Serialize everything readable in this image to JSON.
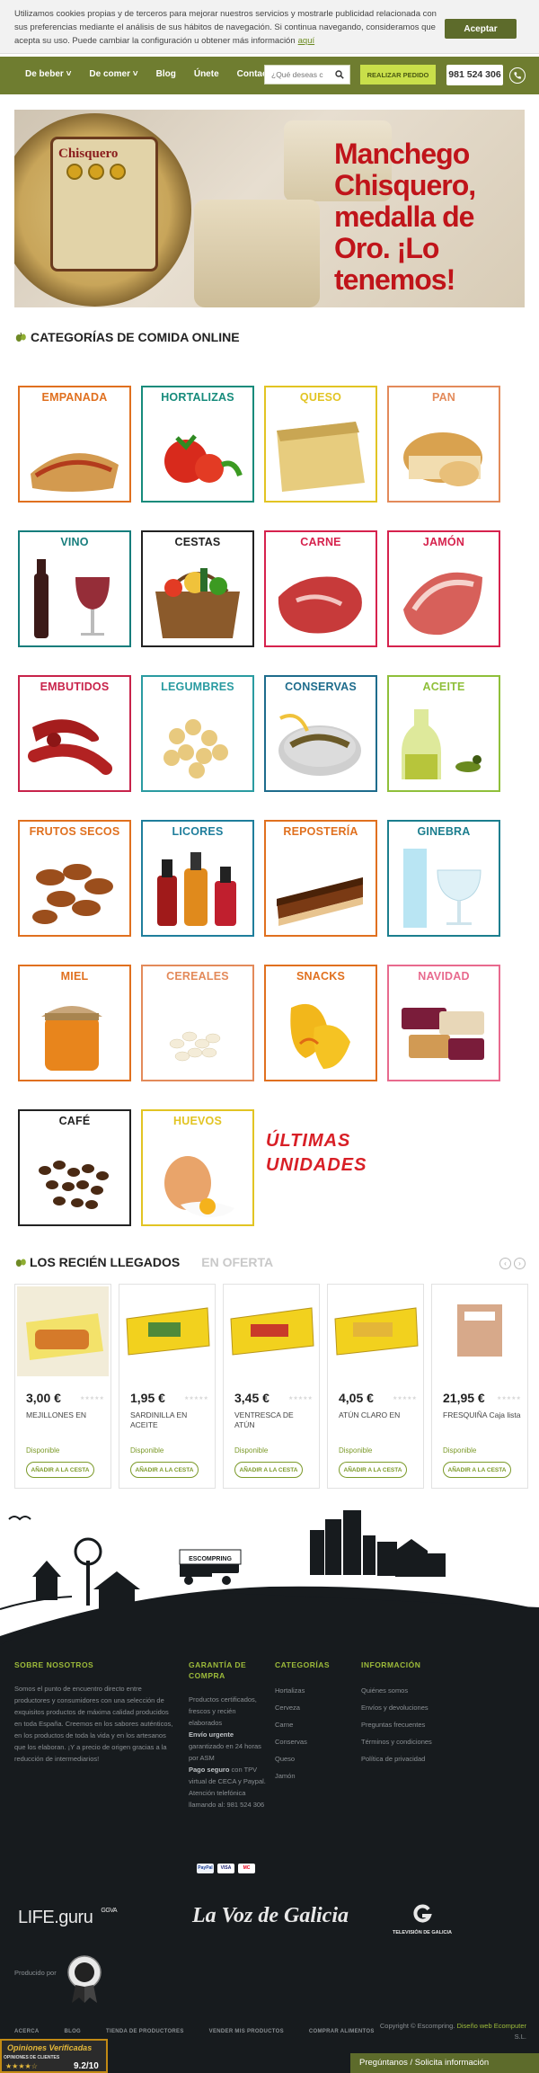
{
  "cookie": {
    "text": "Utilizamos cookies propias y de terceros para mejorar nuestros servicios y mostrarle publicidad relacionada con sus preferencias mediante el análisis de sus hábitos de navegación. Si continua navegando, consideramos que acepta su uso. Puede cambiar la configuración u obtener más información",
    "link": "aquí",
    "accept": "Aceptar"
  },
  "nav": {
    "items": [
      "De beber ˅",
      "De comer ˅",
      "Blog",
      "Únete",
      "Contacto"
    ],
    "search_placeholder": "¿Qué deseas c",
    "order_button": "REALIZAR PEDIDO",
    "phone": "981 524 306"
  },
  "banner": {
    "headline": "Manchego Chisquero, medalla de Oro. ¡Lo tenemos!",
    "label_text": "Chisquero"
  },
  "categories_title": "CATEGORÍAS DE COMIDA ONLINE",
  "categories": [
    {
      "label": "EMPANADA",
      "color": "#e0701f"
    },
    {
      "label": "HORTALIZAS",
      "color": "#168b7b"
    },
    {
      "label": "QUESO",
      "color": "#e2c423"
    },
    {
      "label": "PAN",
      "color": "#e38a5a"
    },
    {
      "label": "VINO",
      "color": "#167d7c"
    },
    {
      "label": "CESTAS",
      "color": "#222222"
    },
    {
      "label": "CARNE",
      "color": "#d6224d"
    },
    {
      "label": "JAMÓN",
      "color": "#d6224d"
    },
    {
      "label": "EMBUTIDOS",
      "color": "#c8234a"
    },
    {
      "label": "LEGUMBRES",
      "color": "#2a9ba1"
    },
    {
      "label": "CONSERVAS",
      "color": "#1e6c8c"
    },
    {
      "label": "ACEITE",
      "color": "#8fbf3a"
    },
    {
      "label": "FRUTOS SECOS",
      "color": "#e0701f"
    },
    {
      "label": "LICORES",
      "color": "#1f7e9c"
    },
    {
      "label": "REPOSTERÍA",
      "color": "#e0701f"
    },
    {
      "label": "GINEBRA",
      "color": "#1b7e8e"
    },
    {
      "label": "MIEL",
      "color": "#e0701f"
    },
    {
      "label": "CEREALES",
      "color": "#e38a5a"
    },
    {
      "label": "SNACKS",
      "color": "#e0701f"
    },
    {
      "label": "NAVIDAD",
      "color": "#e86a8e"
    },
    {
      "label": "CAFÉ",
      "color": "#222222"
    },
    {
      "label": "HUEVOS",
      "color": "#e2c423"
    }
  ],
  "ultimas": "ÚLTIMAS UNIDADES",
  "tabs": {
    "recent": "LOS RECIÉN LLEGADOS",
    "offer": "EN OFERTA"
  },
  "products": [
    {
      "price": "3,00 €",
      "name": "MEJILLONES EN",
      "availability": "Disponible",
      "button": "AÑADIR A LA CESTA"
    },
    {
      "price": "1,95 €",
      "name": "SARDINILLA EN ACEITE",
      "availability": "Disponible",
      "button": "AÑADIR A LA CESTA"
    },
    {
      "price": "3,45 €",
      "name": "VENTRESCA DE ATÚN",
      "availability": "Disponible",
      "button": "AÑADIR A LA CESTA"
    },
    {
      "price": "4,05 €",
      "name": "ATÚN CLARO EN",
      "availability": "Disponible",
      "button": "AÑADIR A LA CESTA"
    },
    {
      "price": "21,95 €",
      "name": "FRESQUIÑA Caja lista",
      "availability": "Disponible",
      "button": "AÑADIR A LA CESTA"
    }
  ],
  "farm_sign": "ESCOMPRING",
  "footer": {
    "about_title": "SOBRE NOSOTROS",
    "about_text": "Somos el punto de encuentro directo entre productores y consumidores con una selección de exquisitos productos de máxima calidad producidos en toda España. Creemos en los sabores auténticos, en los productos de toda la vida y en los artesanos que los elaboran. ¡Y a precio de origen gracias a la reducción de intermediarios!",
    "guarantee_title": "GARANTÍA DE COMPRA",
    "guarantee_text_1": "Productos certificados, frescos y recién elaborados",
    "guarantee_bold_1": "Envío urgente",
    "guarantee_text_2": "garantizado en 24 horas por ASM",
    "guarantee_bold_2": "Pago seguro",
    "guarantee_text_3": "con TPV virtual de CECA y Paypal. Atención telefónica llamando al: 981 524 306",
    "categories_title": "CATEGORÍAS",
    "categories": [
      "Hortalizas",
      "Cerveza",
      "Carne",
      "Conservas",
      "Queso",
      "Jamón"
    ],
    "info_title": "INFORMACIÓN",
    "info": [
      "Quiénes somos",
      "Envíos y devoluciones",
      "Preguntas frecuentes",
      "Términos y condiciones",
      "Política de privacidad"
    ],
    "payments": [
      "PayPal",
      "VISA",
      "MC"
    ],
    "logos": {
      "life": "LIFE.guru",
      "life_sub": "GGVA",
      "voz": "La Voz de Galicia",
      "tvg": "TELEVISIÓN DE GALICIA"
    },
    "produced_by": "Producido por",
    "bottom_links": [
      "ACERCA",
      "BLOG",
      "TIENDA DE PRODUCTORES",
      "VENDER MIS PRODUCTOS",
      "COMPRAR ALIMENTOS"
    ],
    "copyright_prefix": "Copyright © Escompring.",
    "copyright_link": "Diseño web Ecomputer",
    "copyright_suffix": "S.L.",
    "opinions_title": "Opiniones Verificadas",
    "opinions_sub": "OPINIONES DE CLIENTES",
    "opinions_score": "9.2/10",
    "chat": "Pregúntanos / Solicita información"
  }
}
